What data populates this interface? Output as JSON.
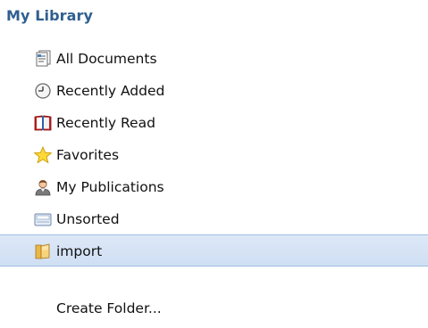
{
  "library": {
    "title": "My Library",
    "items": [
      {
        "label": "All Documents",
        "icon": "documents-icon",
        "selected": false
      },
      {
        "label": "Recently Added",
        "icon": "clock-icon",
        "selected": false
      },
      {
        "label": "Recently Read",
        "icon": "open-book-icon",
        "selected": false
      },
      {
        "label": "Favorites",
        "icon": "star-icon",
        "selected": false
      },
      {
        "label": "My Publications",
        "icon": "person-icon",
        "selected": false
      },
      {
        "label": "Unsorted",
        "icon": "inbox-tray-icon",
        "selected": false
      },
      {
        "label": "import",
        "icon": "folder-icon",
        "selected": true
      }
    ],
    "create_folder_label": "Create Folder..."
  },
  "colors": {
    "title": "#2f5f8f",
    "selection": "#cfdff3",
    "selection_border": "#9ebde4"
  }
}
